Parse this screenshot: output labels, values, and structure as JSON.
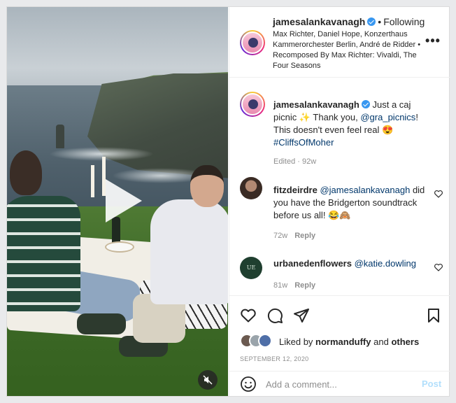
{
  "post": {
    "username": "jamesalankavanagh",
    "separator": "•",
    "follow_status": "Following",
    "audio": "Max Richter, Daniel Hope, Konzerthaus Kammerorchester Berlin, André de Ridder • Recomposed By Max Richter: Vivaldi, The Four Seasons",
    "more_label": "•••"
  },
  "caption": {
    "username": "jamesalankavanagh",
    "text_1": "Just a caj picnic ✨ Thank you,",
    "mention": "@gra_picnics",
    "text_2": "! This doesn't even feel real 😍",
    "hashtag": "#CliffsOfMoher",
    "meta": "Edited · 92w"
  },
  "comments": [
    {
      "username": "fitzdeirdre",
      "mention": "@jamesalankavanagh",
      "text": "did you have the Bridgerton soundtrack before us all! 😂🙈",
      "age": "72w",
      "reply_label": "Reply"
    },
    {
      "username": "urbanedenflowers",
      "mention": "@katie.dowling",
      "text": "",
      "age": "81w",
      "reply_label": "Reply",
      "avatar_text": "UE"
    }
  ],
  "likes": {
    "prefix": "Liked by",
    "user": "normanduffy",
    "conjunction": "and",
    "others": "others"
  },
  "date": "SEPTEMBER 12, 2020",
  "composer": {
    "placeholder": "Add a comment...",
    "post_label": "Post"
  },
  "icons": {
    "play": "play-icon",
    "mute": "muted-speaker-icon",
    "like": "heart-icon",
    "comment": "speech-bubble-icon",
    "share": "paper-plane-icon",
    "save": "bookmark-icon",
    "emoji": "smiley-icon"
  },
  "colors": {
    "link": "#00376b",
    "verified": "#3897f0",
    "post_disabled": "#b2dffc",
    "muted_text": "#8e8e8e"
  }
}
